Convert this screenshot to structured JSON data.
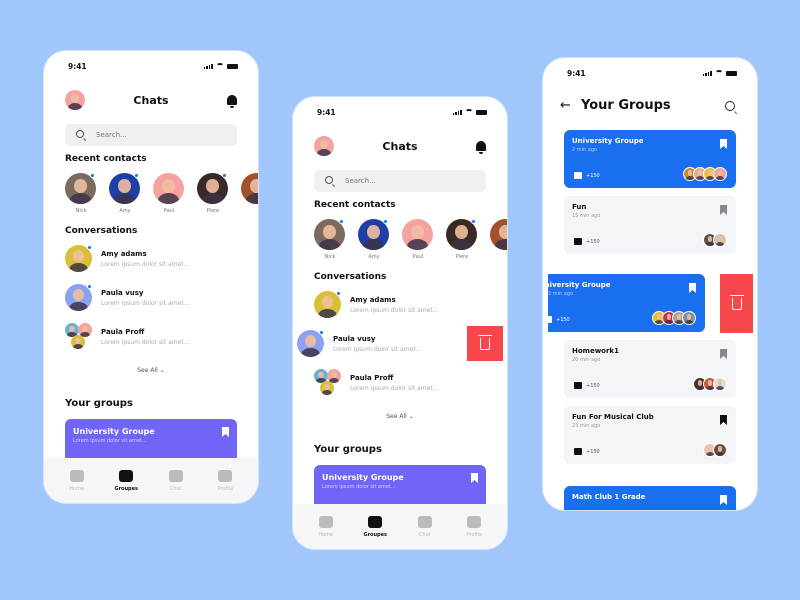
{
  "colors": {
    "background": "#a0c6fc",
    "accent_blue": "#1a6ff0",
    "group_purple": "#7065f6",
    "delete_red": "#f7474b",
    "online_dot": "#1e6ff0"
  },
  "status_time": "9:41",
  "chats_screen": {
    "title": "Chats",
    "search_placeholder": "Search...",
    "recent_title": "Recent contacts",
    "contacts": [
      {
        "name": "Nick",
        "online": true,
        "color": "#7a6a60"
      },
      {
        "name": "Amy",
        "online": true,
        "color": "#1e3fa8"
      },
      {
        "name": "Paul",
        "online": false,
        "color": "#f4a3a0"
      },
      {
        "name": "Piere",
        "online": true,
        "color": "#3a2a26"
      },
      {
        "name": "",
        "online": false,
        "color": "#a0522d"
      }
    ],
    "conversations_title": "Conversations",
    "conversations": [
      {
        "name": "Amy adams",
        "message": "Lorem ipsum dolor sit amet...",
        "online": true,
        "color": "#d9c03a"
      },
      {
        "name": "Paula vusy",
        "message": "Lorem ipsum dolor sit amet...",
        "online": true,
        "color": "#8aa2f0"
      },
      {
        "name": "Paula Proff",
        "message": "Lorem ipsum dolor sit amet...",
        "online": false,
        "group": true
      }
    ],
    "see_all": "See All",
    "groups_title": "Your groups",
    "group_card": {
      "title": "University Groupe",
      "subtitle": "Lorem ipsum dolor sit amet..."
    },
    "nav": [
      {
        "label": "Home",
        "icon": "home-icon"
      },
      {
        "label": "Groupes",
        "icon": "groups-icon",
        "active": true
      },
      {
        "label": "Chat",
        "icon": "chat-icon"
      },
      {
        "label": "Profile",
        "icon": "profile-icon"
      }
    ]
  },
  "groups_screen": {
    "title": "Your Groups",
    "groups": [
      {
        "title": "University Groupe",
        "time": "2 min ago",
        "count": "+150",
        "blue": true,
        "members": [
          "#c98a3a",
          "#e0b090",
          "#e8c040",
          "#f0a0a0"
        ]
      },
      {
        "title": "Fun",
        "time": "15 min ago",
        "count": "+150",
        "members": [
          "#555",
          "#d8c0b0"
        ]
      },
      {
        "title": "University Groupe",
        "time": "2 min ago",
        "count": "+150",
        "blue": true,
        "swiped": true,
        "members": [
          "#e8c020",
          "#d03050",
          "#b0a0a0",
          "#8090a0"
        ]
      },
      {
        "title": "Homework1",
        "time": "20 min ago",
        "count": "+150",
        "members": [
          "#4a3030",
          "#c06040",
          "#e0e0d0"
        ]
      },
      {
        "title": "Fun For Musical Club",
        "time": "23 min ago",
        "count": "+150",
        "bookmark_dark": true,
        "members": [
          "#f0c0b0",
          "#6a5040"
        ]
      },
      {
        "title": "Math Club 1 Grade",
        "time": "",
        "count": "",
        "blue": true,
        "members": []
      }
    ]
  }
}
